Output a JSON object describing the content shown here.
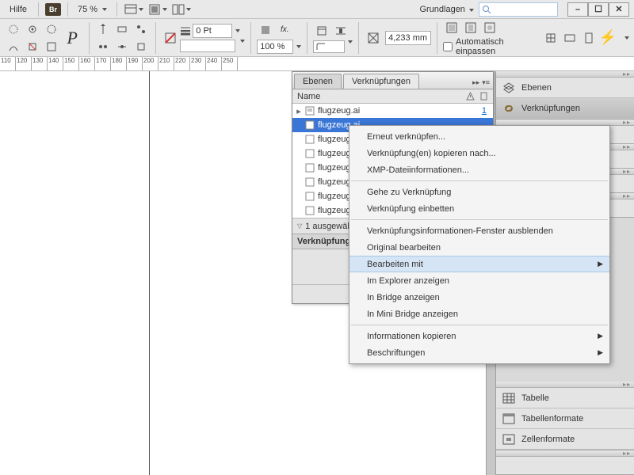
{
  "menubar": {
    "help": "Hilfe",
    "br": "Br",
    "zoom": "75 %",
    "workspace": "Grundlagen"
  },
  "controlbar": {
    "stroke": "0 Pt",
    "opacity": "100 %",
    "size": "4,233 mm",
    "autofit": "Automatisch einpassen"
  },
  "ruler": [
    "110",
    "120",
    "130",
    "140",
    "150",
    "160",
    "170",
    "180",
    "190",
    "200",
    "210",
    "220",
    "230",
    "240",
    "250"
  ],
  "links_panel": {
    "tab_layers": "Ebenen",
    "tab_links": "Verknüpfungen",
    "col_name": "Name",
    "items": [
      {
        "name": "flugzeug.ai",
        "page": "1",
        "sel": false,
        "exp": true
      },
      {
        "name": "flugzeug.ai",
        "page": "",
        "sel": true,
        "exp": false
      },
      {
        "name": "flugzeug.ai",
        "page": "",
        "sel": false,
        "exp": false
      },
      {
        "name": "flugzeug.ai",
        "page": "",
        "sel": false,
        "exp": false
      },
      {
        "name": "flugzeug.ai",
        "page": "",
        "sel": false,
        "exp": false
      },
      {
        "name": "flugzeug.ai",
        "page": "",
        "sel": false,
        "exp": false
      },
      {
        "name": "flugzeug.ai",
        "page": "",
        "sel": false,
        "exp": false
      },
      {
        "name": "flugzeug.ai",
        "page": "",
        "sel": false,
        "exp": false
      }
    ],
    "status": "1 ausgewählt",
    "info_head": "Verknüpfungs"
  },
  "context": {
    "items": [
      {
        "t": "Erneut verknüpfen...",
        "sub": false
      },
      {
        "t": "Verknüpfung(en) kopieren nach...",
        "sub": false
      },
      {
        "t": "XMP-Dateiinformationen...",
        "sub": false
      },
      {
        "sep": true
      },
      {
        "t": "Gehe zu Verknüpfung",
        "sub": false
      },
      {
        "t": "Verknüpfung einbetten",
        "sub": false
      },
      {
        "sep": true
      },
      {
        "t": "Verknüpfungsinformationen-Fenster ausblenden",
        "sub": false
      },
      {
        "t": "Original bearbeiten",
        "sub": false
      },
      {
        "t": "Bearbeiten mit",
        "sub": true,
        "hl": true
      },
      {
        "t": "Im Explorer anzeigen",
        "sub": false
      },
      {
        "t": "In Bridge anzeigen",
        "sub": false
      },
      {
        "t": "In Mini Bridge anzeigen",
        "sub": false
      },
      {
        "sep": true
      },
      {
        "t": "Informationen kopieren",
        "sub": true
      },
      {
        "t": "Beschriftungen",
        "sub": true
      }
    ]
  },
  "dock": {
    "layers": "Ebenen",
    "links": "Verknüpfungen",
    "table": "Tabelle",
    "table_formats": "Tabellenformate",
    "cell_formats": "Zellenformate"
  }
}
